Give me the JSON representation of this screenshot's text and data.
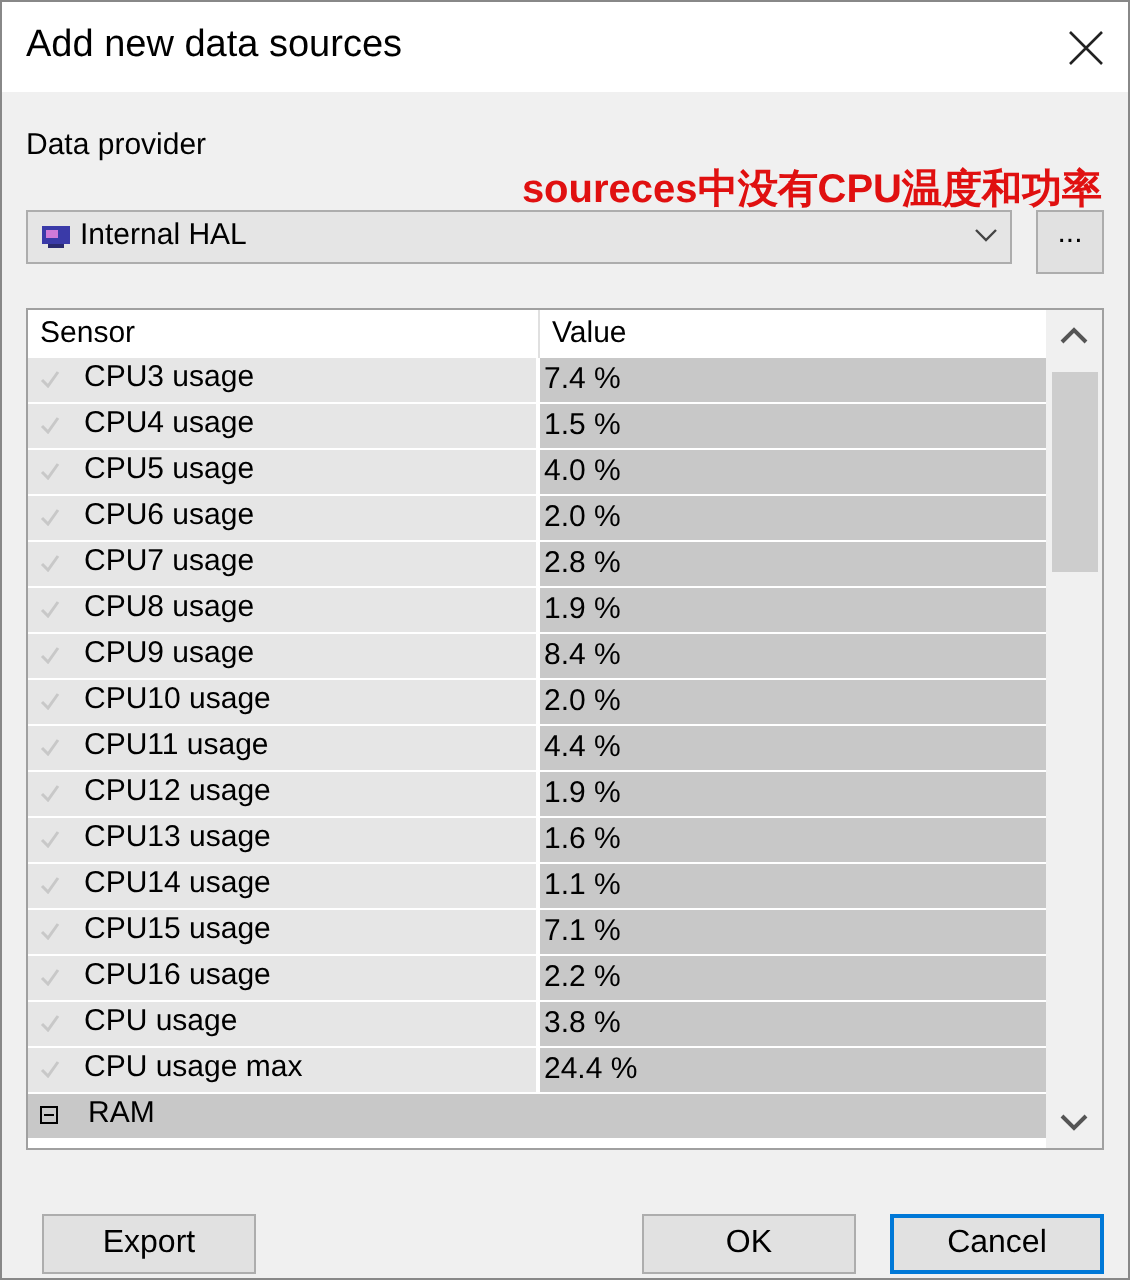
{
  "window": {
    "title": "Add new data sources"
  },
  "provider_label": "Data provider",
  "annotation": "soureces中没有CPU温度和功率",
  "provider": {
    "value": "Internal HAL"
  },
  "more_button": "...",
  "table": {
    "columns": [
      "Sensor",
      "Value"
    ],
    "rows": [
      {
        "kind": "sensor",
        "name": "CPU3 usage",
        "value": "7.4 %"
      },
      {
        "kind": "sensor",
        "name": "CPU4 usage",
        "value": "1.5 %"
      },
      {
        "kind": "sensor",
        "name": "CPU5 usage",
        "value": "4.0 %"
      },
      {
        "kind": "sensor",
        "name": "CPU6 usage",
        "value": "2.0 %"
      },
      {
        "kind": "sensor",
        "name": "CPU7 usage",
        "value": "2.8 %"
      },
      {
        "kind": "sensor",
        "name": "CPU8 usage",
        "value": "1.9 %"
      },
      {
        "kind": "sensor",
        "name": "CPU9 usage",
        "value": "8.4 %"
      },
      {
        "kind": "sensor",
        "name": "CPU10 usage",
        "value": "2.0 %"
      },
      {
        "kind": "sensor",
        "name": "CPU11 usage",
        "value": "4.4 %"
      },
      {
        "kind": "sensor",
        "name": "CPU12 usage",
        "value": "1.9 %"
      },
      {
        "kind": "sensor",
        "name": "CPU13 usage",
        "value": "1.6 %"
      },
      {
        "kind": "sensor",
        "name": "CPU14 usage",
        "value": "1.1 %"
      },
      {
        "kind": "sensor",
        "name": "CPU15 usage",
        "value": "7.1 %"
      },
      {
        "kind": "sensor",
        "name": "CPU16 usage",
        "value": "2.2 %"
      },
      {
        "kind": "sensor",
        "name": "CPU usage",
        "value": "3.8 %"
      },
      {
        "kind": "sensor",
        "name": "CPU usage max",
        "value": "24.4 %"
      },
      {
        "kind": "group",
        "name": "RAM",
        "expanded": true
      }
    ]
  },
  "buttons": [
    {
      "label": "Export",
      "default": false
    },
    {
      "label": "OK",
      "default": false
    },
    {
      "label": "Cancel",
      "default": true
    }
  ]
}
